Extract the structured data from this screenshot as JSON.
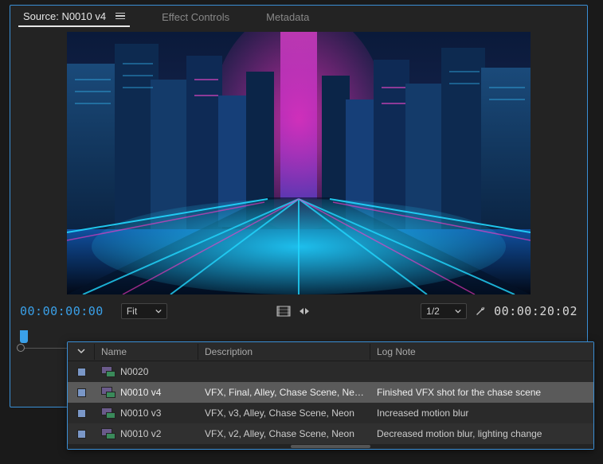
{
  "tabs": {
    "source_prefix": "Source:",
    "source_name": "N0010 v4",
    "effect_controls": "Effect Controls",
    "metadata": "Metadata"
  },
  "controls": {
    "tc_in": "00:00:00:00",
    "tc_out": "00:00:20:02",
    "zoom_label": "Fit",
    "res_label": "1/2"
  },
  "project": {
    "col_name": "Name",
    "col_desc": "Description",
    "col_note": "Log Note",
    "rows": [
      {
        "name": "N0020",
        "desc": "",
        "note": ""
      },
      {
        "name": "N0010 v4",
        "desc": "VFX, Final, Alley, Chase Scene, Neon",
        "note": "Finished VFX shot for the chase scene"
      },
      {
        "name": "N0010 v3",
        "desc": "VFX, v3, Alley, Chase Scene, Neon",
        "note": "Increased motion blur"
      },
      {
        "name": "N0010 v2",
        "desc": "VFX, v2, Alley, Chase Scene, Neon",
        "note": "Decreased motion blur, lighting change"
      }
    ]
  }
}
